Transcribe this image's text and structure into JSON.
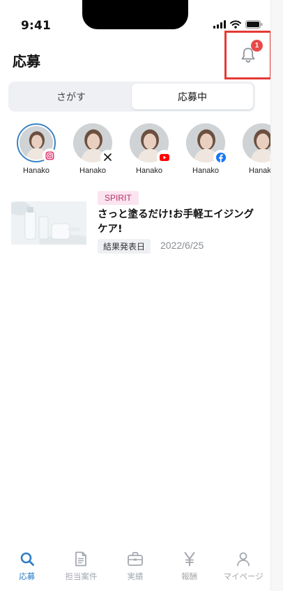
{
  "status_bar": {
    "time": "9:41"
  },
  "header": {
    "title": "応募",
    "notification_count": "1"
  },
  "segments": [
    {
      "label": "さがす",
      "active": false
    },
    {
      "label": "応募中",
      "active": true
    }
  ],
  "accounts": [
    {
      "name": "Hanako",
      "sns": "instagram-icon",
      "selected": true
    },
    {
      "name": "Hanako",
      "sns": "x-icon",
      "selected": false
    },
    {
      "name": "Hanako",
      "sns": "youtube-icon",
      "selected": false
    },
    {
      "name": "Hanako",
      "sns": "facebook-icon",
      "selected": false
    },
    {
      "name": "Hanako",
      "sns": "other-sns-icon",
      "selected": false
    }
  ],
  "campaign": {
    "tag": "SPIRIT",
    "title": "さっと塗るだけ!お手軽エイジングケア!",
    "status": "結果発表日",
    "date": "2022/6/25"
  },
  "tabbar": [
    {
      "label": "応募",
      "icon": "search-icon",
      "active": true
    },
    {
      "label": "担当案件",
      "icon": "document-icon",
      "active": false
    },
    {
      "label": "実績",
      "icon": "briefcase-icon",
      "active": false
    },
    {
      "label": "報酬",
      "icon": "yen-icon",
      "active": false
    },
    {
      "label": "マイページ",
      "icon": "person-icon",
      "active": false
    }
  ],
  "colors": {
    "accent": "#2f7fc4",
    "badge": "#e84a4a",
    "highlight_frame": "#e53935",
    "tag_bg": "#fbe4ef",
    "tag_text": "#b4306a"
  }
}
